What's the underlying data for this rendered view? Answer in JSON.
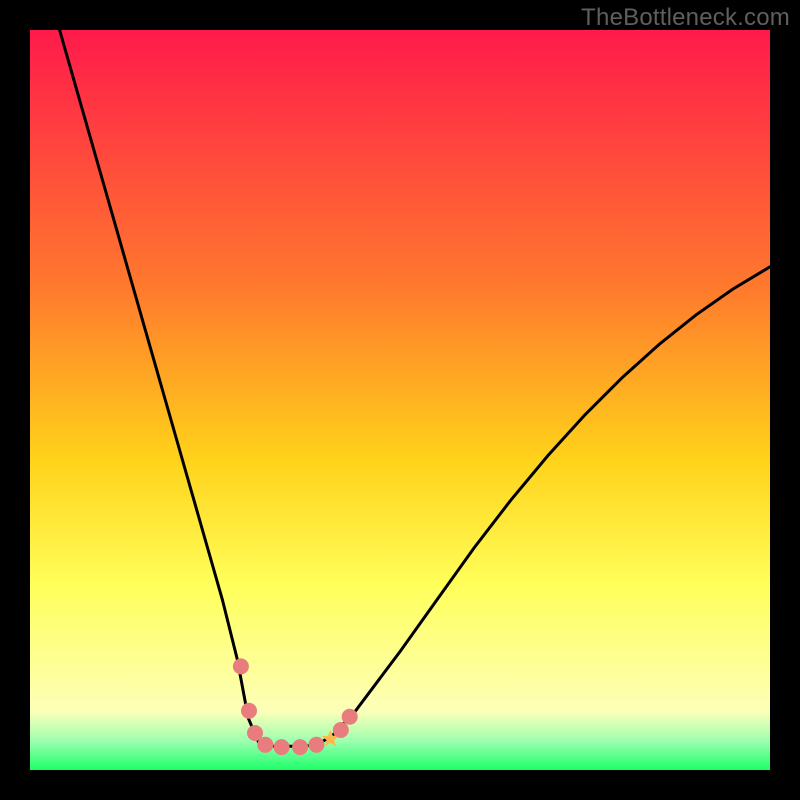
{
  "watermark": "TheBottleneck.com",
  "colors": {
    "gradient_top": "#ff1a4b",
    "gradient_mid1": "#ff7a2d",
    "gradient_mid2": "#ffd21a",
    "gradient_mid3": "#ffff5a",
    "gradient_mid4": "#fdffb8",
    "gradient_bottom": "#1dff6a",
    "curve": "#000000",
    "marker": "#e97c7c",
    "marker_star": "#ffb84a"
  },
  "chart_data": {
    "type": "line",
    "title": "",
    "xlabel": "",
    "ylabel": "",
    "xlim": [
      0,
      100
    ],
    "ylim": [
      0,
      100
    ],
    "series": [
      {
        "name": "curve",
        "x": [
          4,
          6,
          8,
          10,
          12,
          14,
          16,
          18,
          20,
          22,
          24,
          26,
          28,
          29.5,
          31,
          33,
          35,
          37,
          39,
          41,
          44,
          47,
          50,
          55,
          60,
          65,
          70,
          75,
          80,
          85,
          90,
          95,
          100
        ],
        "y": [
          100,
          93,
          86,
          79,
          72,
          65,
          58,
          51,
          44,
          37,
          30,
          23,
          15,
          7,
          3.5,
          3.2,
          3.2,
          3.2,
          3.5,
          4.8,
          8,
          12,
          16,
          23,
          30,
          36.5,
          42.5,
          48,
          53,
          57.5,
          61.5,
          65,
          68
        ]
      }
    ],
    "markers": [
      {
        "name": "dot-left-1",
        "x": 28.5,
        "y": 14,
        "kind": "dot"
      },
      {
        "name": "dot-left-2",
        "x": 29.6,
        "y": 8,
        "kind": "dot"
      },
      {
        "name": "dot-left-3",
        "x": 30.4,
        "y": 5,
        "kind": "dot"
      },
      {
        "name": "dot-mid-1",
        "x": 31.8,
        "y": 3.4,
        "kind": "dot"
      },
      {
        "name": "dot-mid-2",
        "x": 34.0,
        "y": 3.1,
        "kind": "dot"
      },
      {
        "name": "dot-mid-3",
        "x": 36.5,
        "y": 3.1,
        "kind": "dot"
      },
      {
        "name": "dot-mid-4",
        "x": 38.7,
        "y": 3.4,
        "kind": "dot"
      },
      {
        "name": "star",
        "x": 40.6,
        "y": 4.2,
        "kind": "star"
      },
      {
        "name": "dot-right-1",
        "x": 42.0,
        "y": 5.4,
        "kind": "dot"
      },
      {
        "name": "dot-right-2",
        "x": 43.2,
        "y": 7.2,
        "kind": "dot"
      }
    ],
    "green_band_y": [
      0,
      5
    ],
    "yellow_band_y": [
      5,
      25
    ]
  }
}
